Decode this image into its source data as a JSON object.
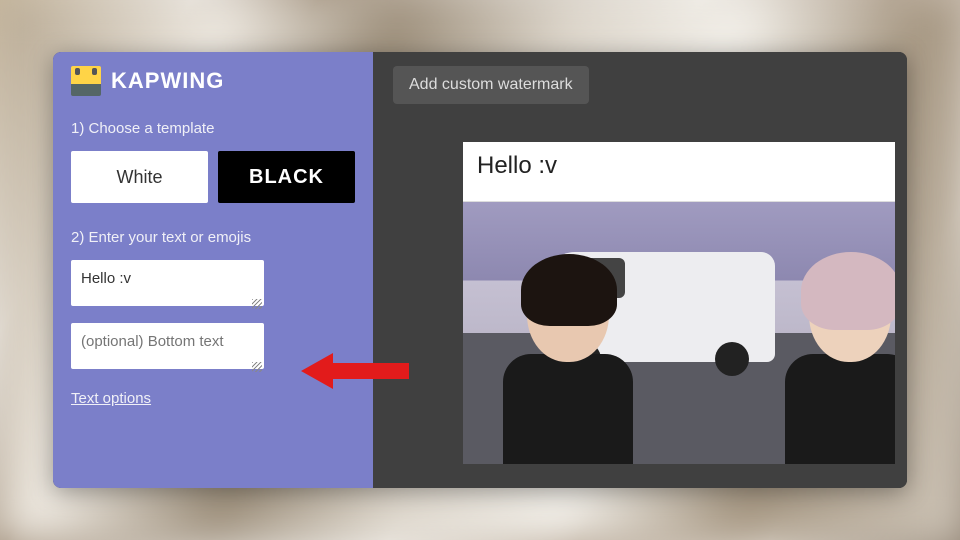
{
  "brand": {
    "name": "KAPWING"
  },
  "sidebar": {
    "step1_label": "1) Choose a template",
    "template_white": "White",
    "template_black": "BLACK",
    "step2_label": "2) Enter your text or emojis",
    "top_text_value": "Hello :v",
    "bottom_text_placeholder": "(optional) Bottom text",
    "text_options_link": "Text options"
  },
  "toolbar": {
    "watermark_button": "Add custom watermark"
  },
  "preview": {
    "caption": "Hello :v"
  },
  "annotation": {
    "arrow_color": "#e21b1b"
  }
}
